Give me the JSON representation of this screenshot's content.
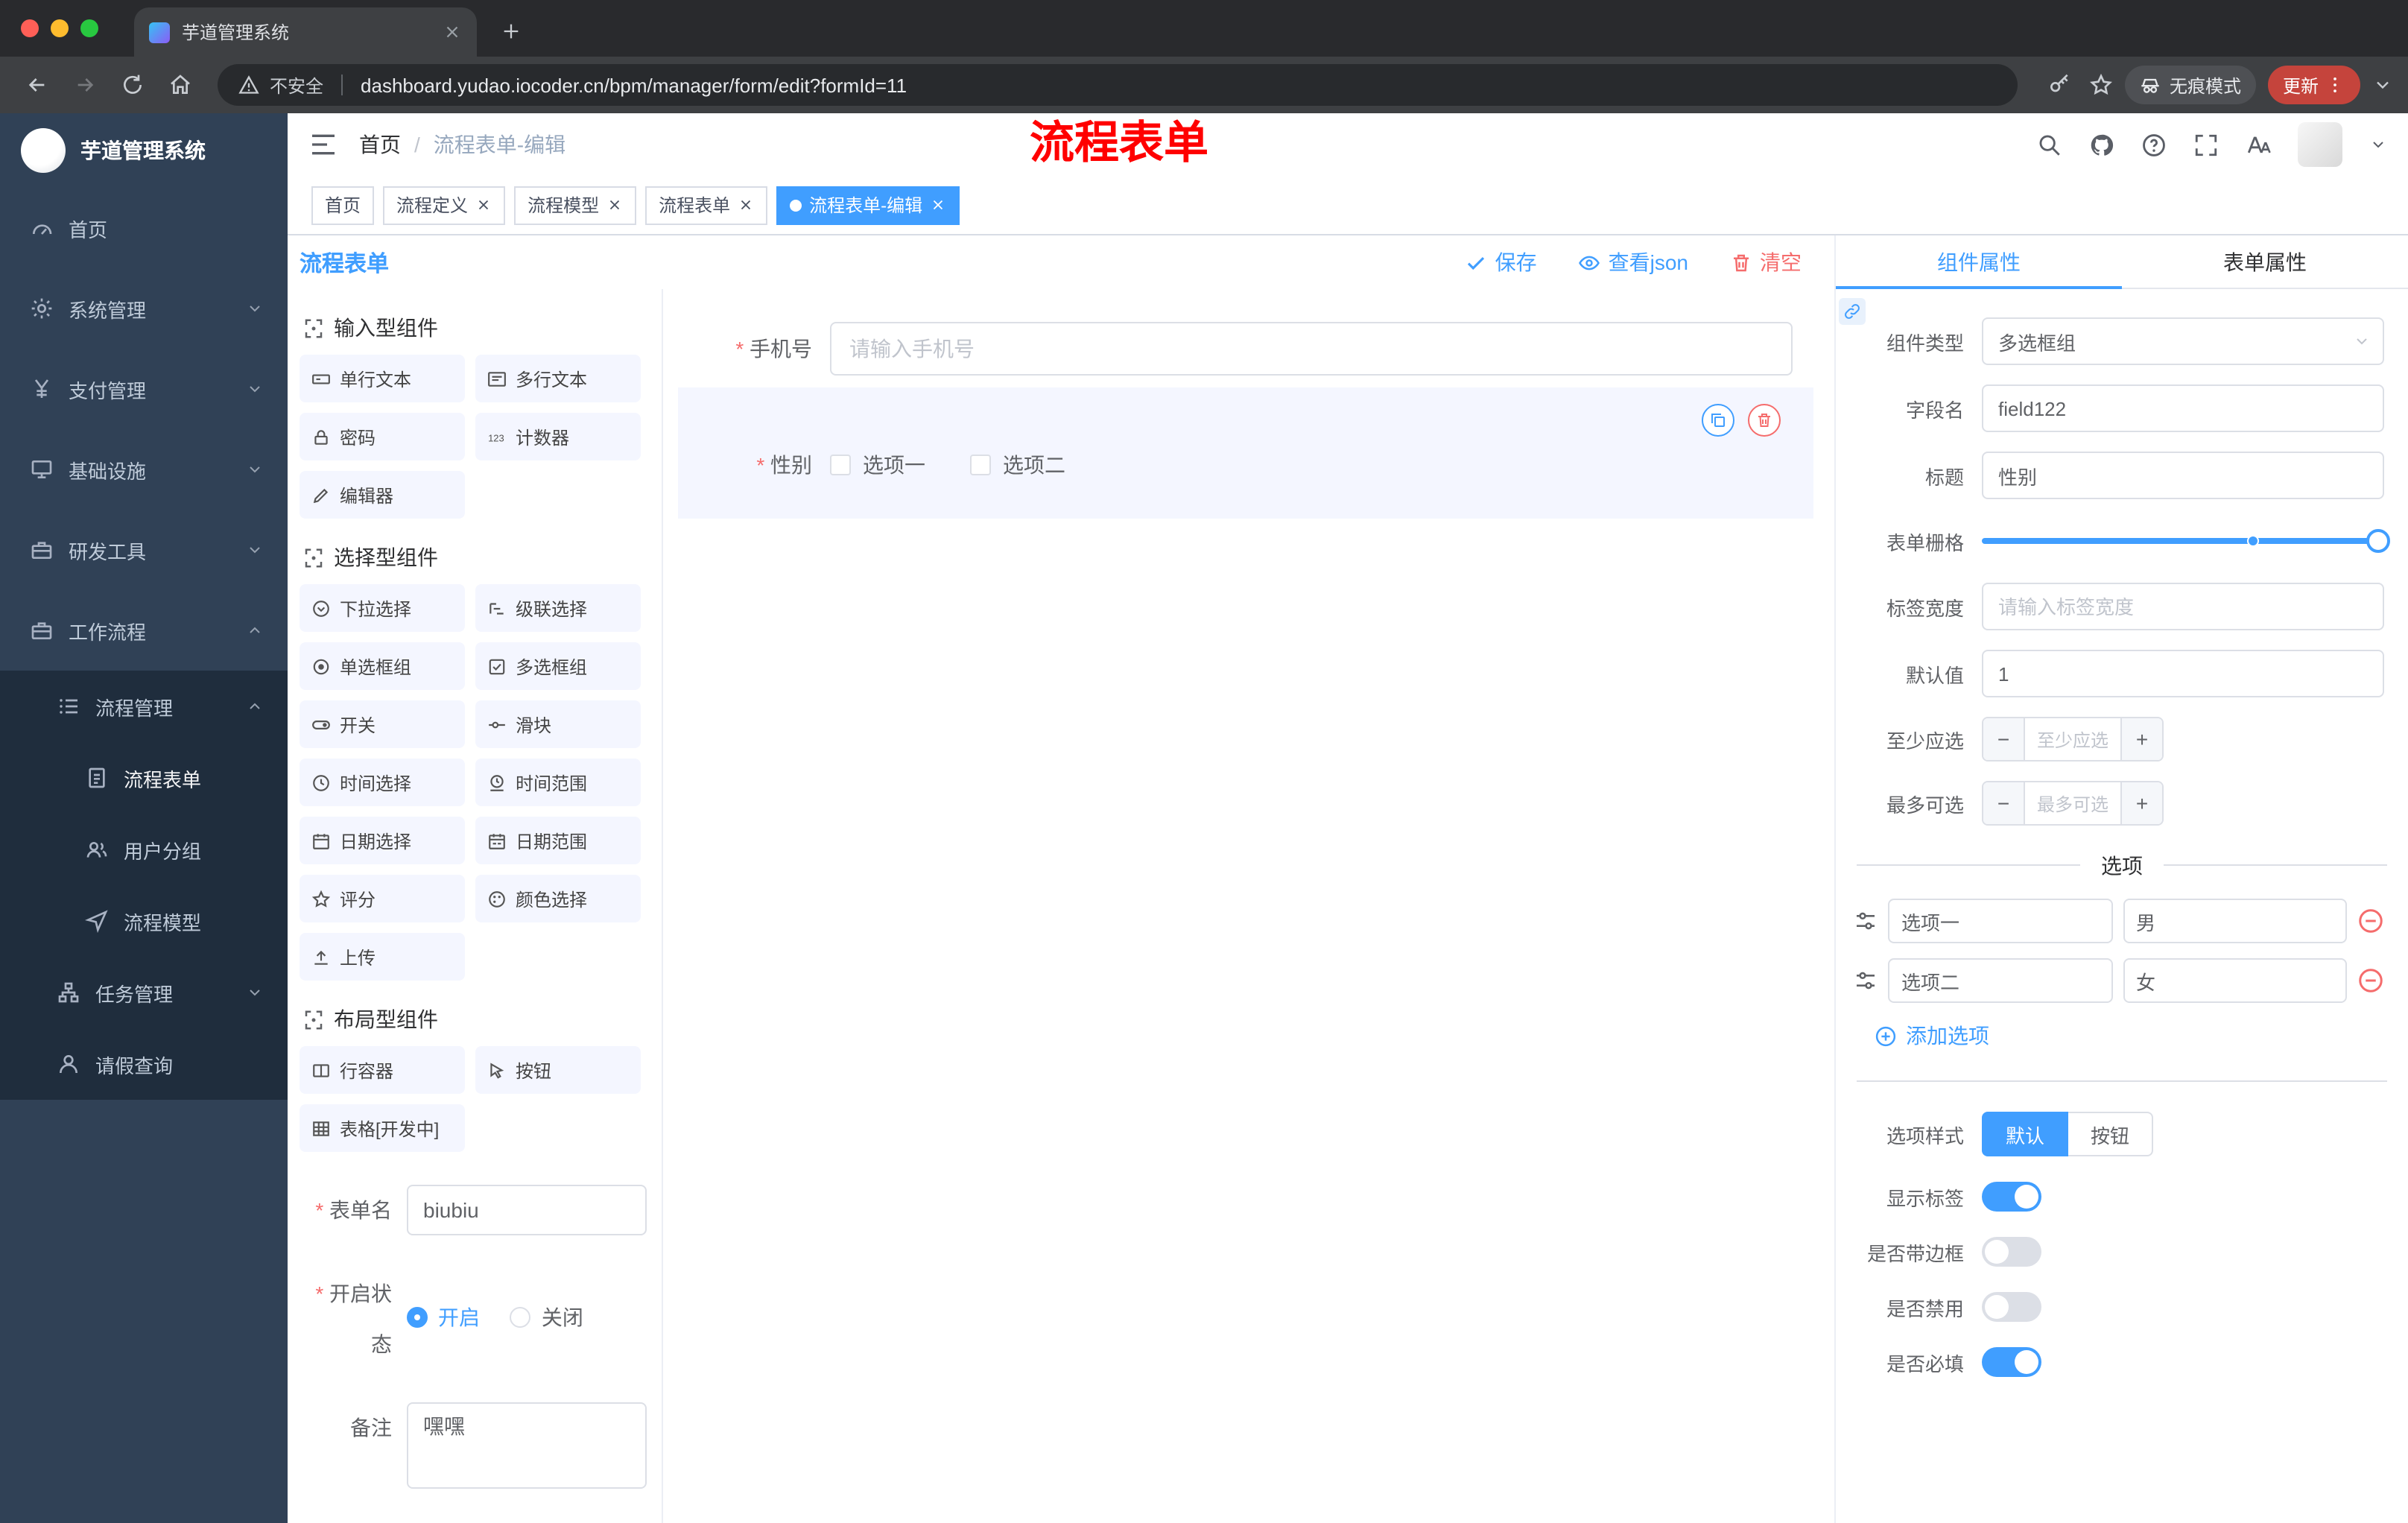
{
  "browser": {
    "tab_title": "芋道管理系统",
    "security": "不安全",
    "url": "dashboard.yudao.iocoder.cn/bpm/manager/form/edit?formId=11",
    "incognito": "无痕模式",
    "update": "更新"
  },
  "annotation": {
    "text": "流程表单"
  },
  "header": {
    "breadcrumb_home": "首页",
    "breadcrumb_sep": "/",
    "breadcrumb_current": "流程表单-编辑"
  },
  "sidebar": {
    "logo": "芋道管理系统",
    "items": [
      {
        "label": "首页"
      },
      {
        "label": "系统管理"
      },
      {
        "label": "支付管理"
      },
      {
        "label": "基础设施"
      },
      {
        "label": "研发工具"
      },
      {
        "label": "工作流程"
      }
    ],
    "process_manage": "流程管理",
    "process_children": [
      {
        "label": "流程表单"
      },
      {
        "label": "用户分组"
      },
      {
        "label": "流程模型"
      }
    ],
    "task_manage": "任务管理",
    "leave_query": "请假查询"
  },
  "tags": [
    {
      "label": "首页"
    },
    {
      "label": "流程定义"
    },
    {
      "label": "流程模型"
    },
    {
      "label": "流程表单"
    },
    {
      "label": "流程表单-编辑"
    }
  ],
  "designer": {
    "title": "流程表单",
    "save": "保存",
    "view_json": "查看json",
    "clear": "清空"
  },
  "palette": {
    "groups": [
      {
        "title": "输入型组件",
        "items": [
          {
            "label": "单行文本"
          },
          {
            "label": "多行文本"
          },
          {
            "label": "密码"
          },
          {
            "label": "计数器"
          },
          {
            "label": "编辑器"
          }
        ]
      },
      {
        "title": "选择型组件",
        "items": [
          {
            "label": "下拉选择"
          },
          {
            "label": "级联选择"
          },
          {
            "label": "单选框组"
          },
          {
            "label": "多选框组"
          },
          {
            "label": "开关"
          },
          {
            "label": "滑块"
          },
          {
            "label": "时间选择"
          },
          {
            "label": "时间范围"
          },
          {
            "label": "日期选择"
          },
          {
            "label": "日期范围"
          },
          {
            "label": "评分"
          },
          {
            "label": "颜色选择"
          },
          {
            "label": "上传"
          }
        ]
      },
      {
        "title": "布局型组件",
        "items": [
          {
            "label": "行容器"
          },
          {
            "label": "按钮"
          },
          {
            "label": "表格[开发中]"
          }
        ]
      }
    ]
  },
  "meta": {
    "form_name_label": "表单名",
    "form_name_value": "biubiu",
    "status_label": "开启状态",
    "status_on": "开启",
    "status_off": "关闭",
    "remark_label": "备注",
    "remark_value": "嘿嘿"
  },
  "canvas": {
    "phone_label": "手机号",
    "phone_placeholder": "请输入手机号",
    "gender_label": "性别",
    "gender_options": [
      {
        "label": "选项一"
      },
      {
        "label": "选项二"
      }
    ]
  },
  "panel": {
    "tab_component": "组件属性",
    "tab_form": "表单属性",
    "type_label": "组件类型",
    "type_value": "多选框组",
    "field_label": "字段名",
    "field_value": "field122",
    "title_label": "标题",
    "title_value": "性别",
    "grid_label": "表单栅格",
    "width_label": "标签宽度",
    "width_placeholder": "请输入标签宽度",
    "default_label": "默认值",
    "default_value": "1",
    "min_label": "至少应选",
    "min_placeholder": "至少应选",
    "max_label": "最多可选",
    "max_placeholder": "最多可选",
    "options_title": "选项",
    "options": [
      {
        "label": "选项一",
        "value": "男"
      },
      {
        "label": "选项二",
        "value": "女"
      }
    ],
    "add_option": "添加选项",
    "style_label": "选项样式",
    "style_default": "默认",
    "style_button": "按钮",
    "switches": [
      {
        "label": "显示标签",
        "on": true
      },
      {
        "label": "是否带边框",
        "on": false
      },
      {
        "label": "是否禁用",
        "on": false
      },
      {
        "label": "是否必填",
        "on": true
      }
    ]
  },
  "colors": {
    "accent": "#409eff",
    "danger": "#f56c6c",
    "sidebar_bg": "#304156",
    "annotation": "#ff0000"
  }
}
